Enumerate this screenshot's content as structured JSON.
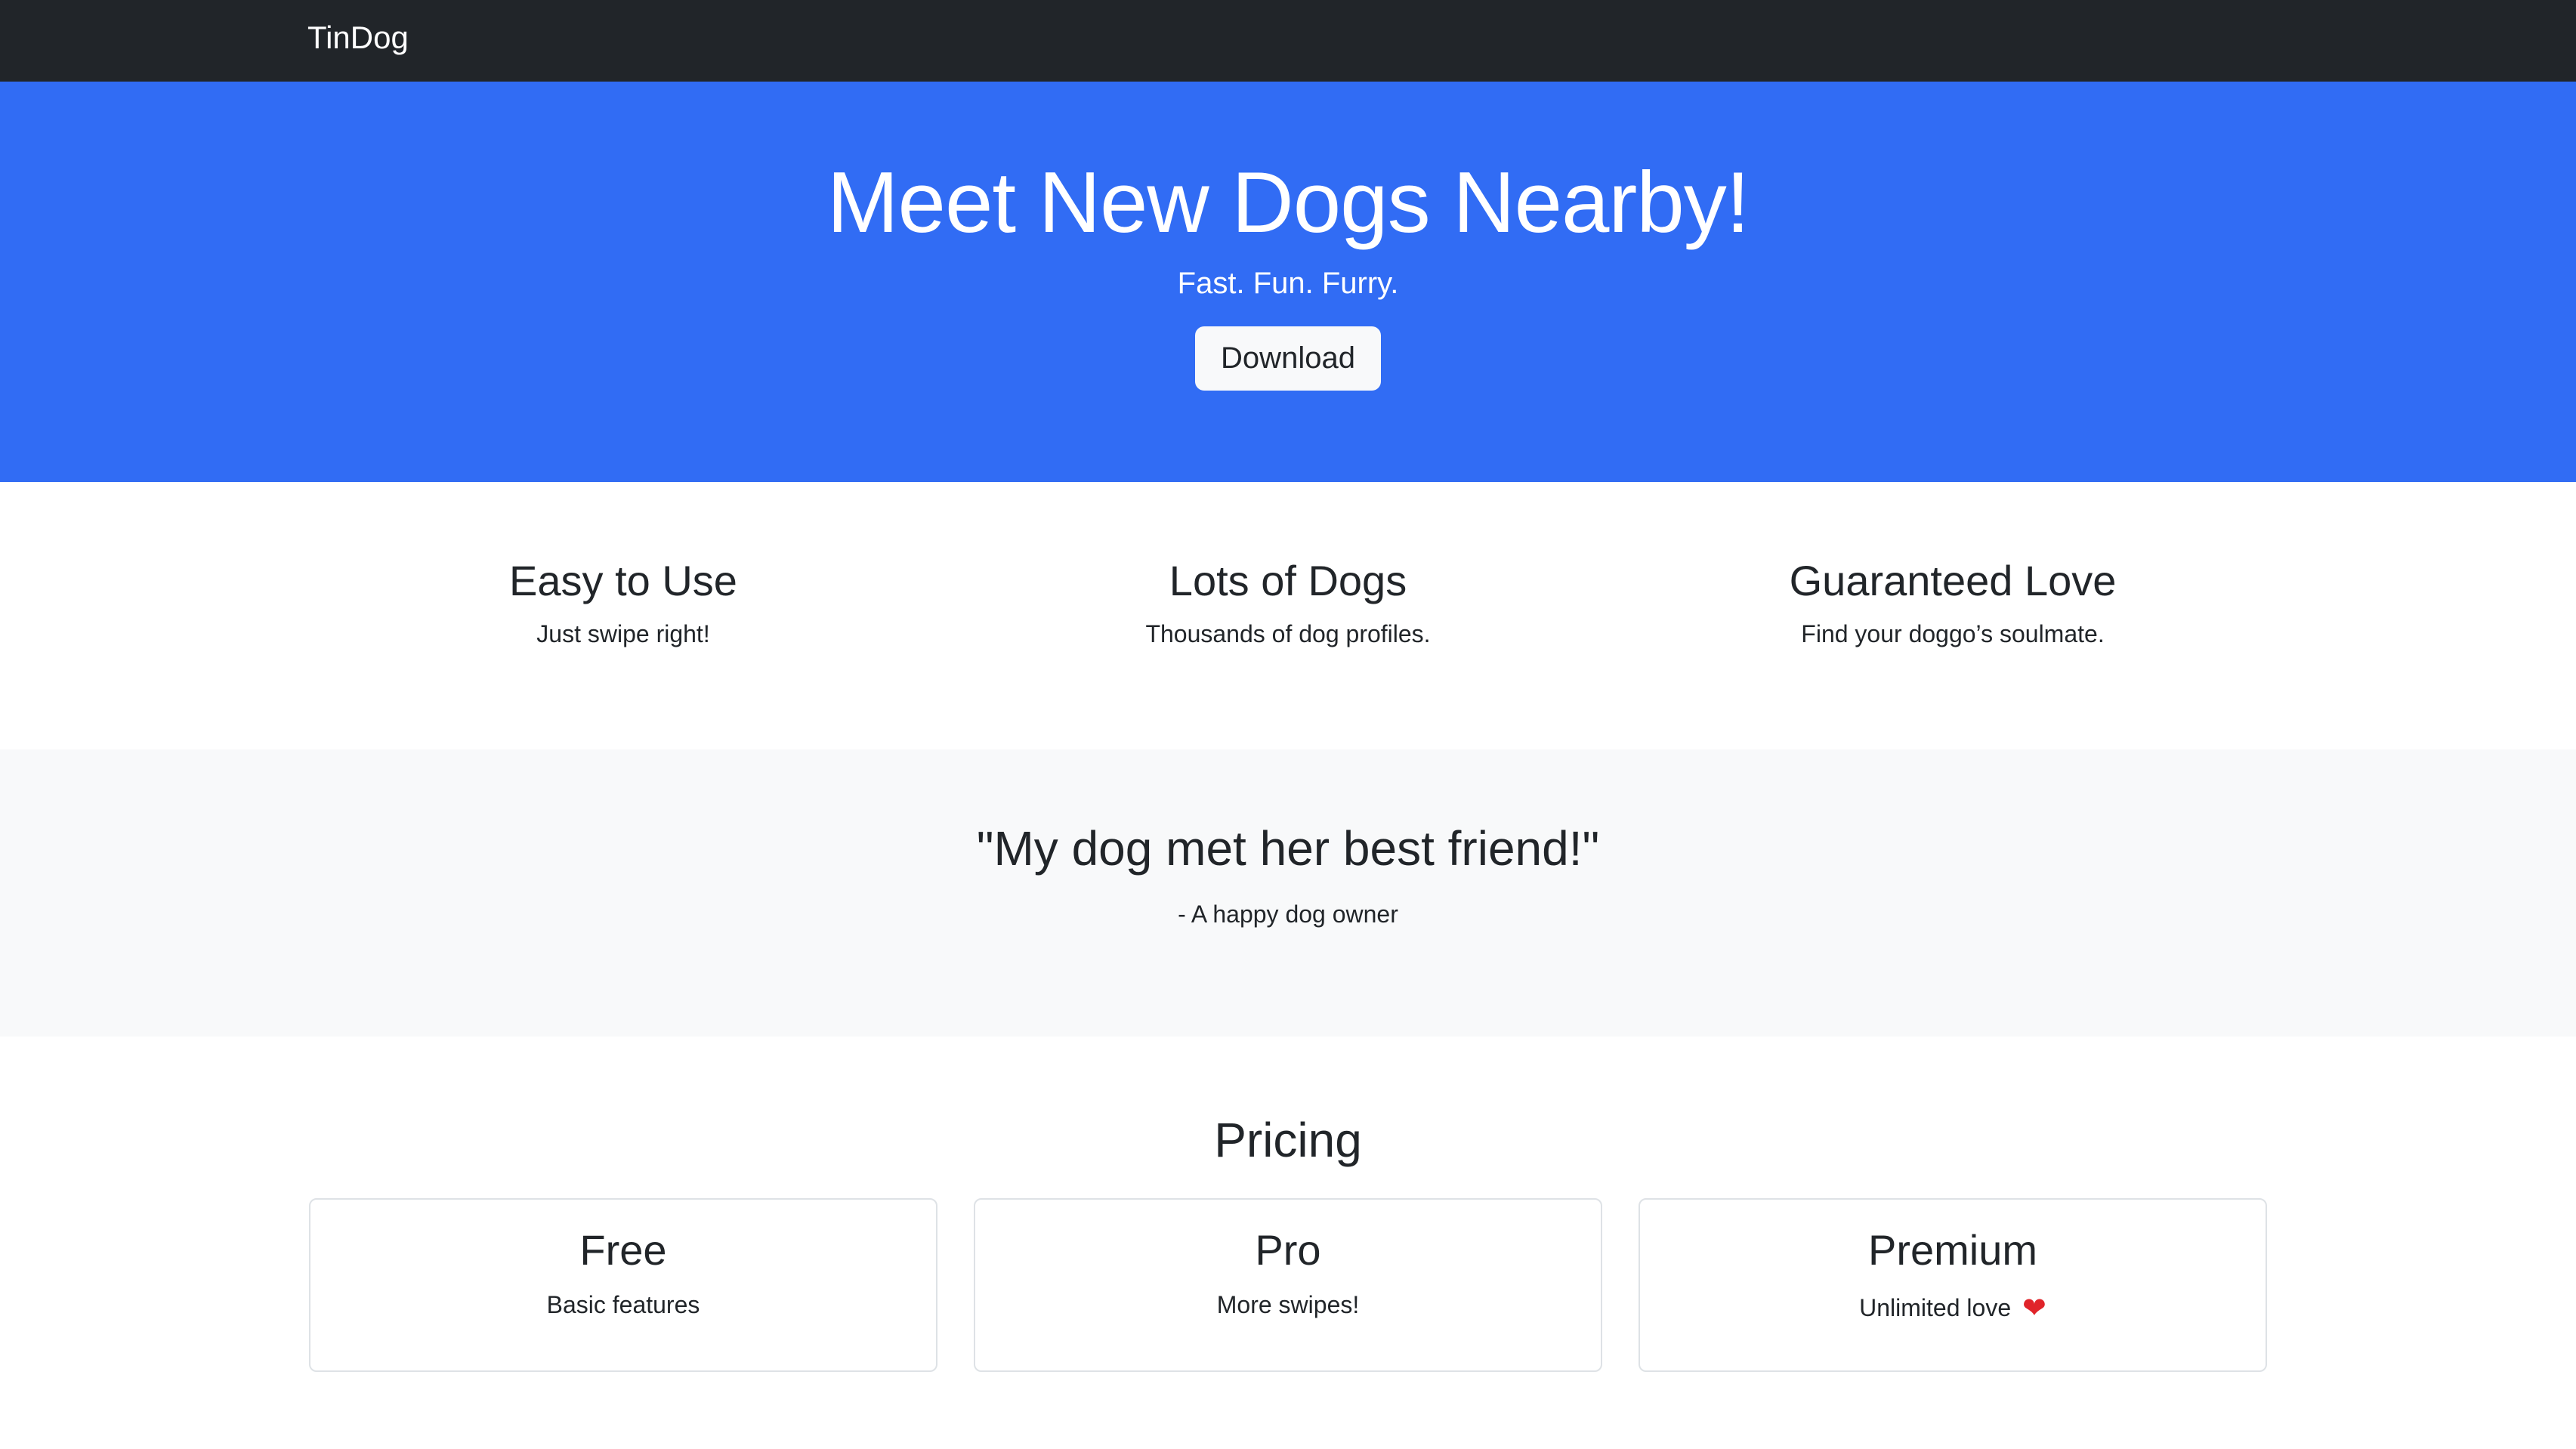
{
  "navbar": {
    "brand": "TinDog"
  },
  "hero": {
    "title": "Meet New Dogs Nearby!",
    "subtitle": "Fast. Fun. Furry.",
    "button_label": "Download"
  },
  "features": [
    {
      "title": "Easy to Use",
      "text": "Just swipe right!"
    },
    {
      "title": "Lots of Dogs",
      "text": "Thousands of dog profiles."
    },
    {
      "title": "Guaranteed Love",
      "text": "Find your doggo’s soulmate."
    }
  ],
  "testimonial": {
    "quote": "\"My dog met her best friend!\"",
    "author": "- A happy dog owner"
  },
  "pricing": {
    "title": "Pricing",
    "plans": [
      {
        "name": "Free",
        "description": "Basic features"
      },
      {
        "name": "Pro",
        "description": "More swipes!"
      },
      {
        "name": "Premium",
        "description": "Unlimited love",
        "icon": "heart-icon"
      }
    ]
  },
  "colors": {
    "navbar": "#212529",
    "hero": "#316cf4",
    "section_alt": "#f8f9fa",
    "heart": "#e0242a"
  }
}
